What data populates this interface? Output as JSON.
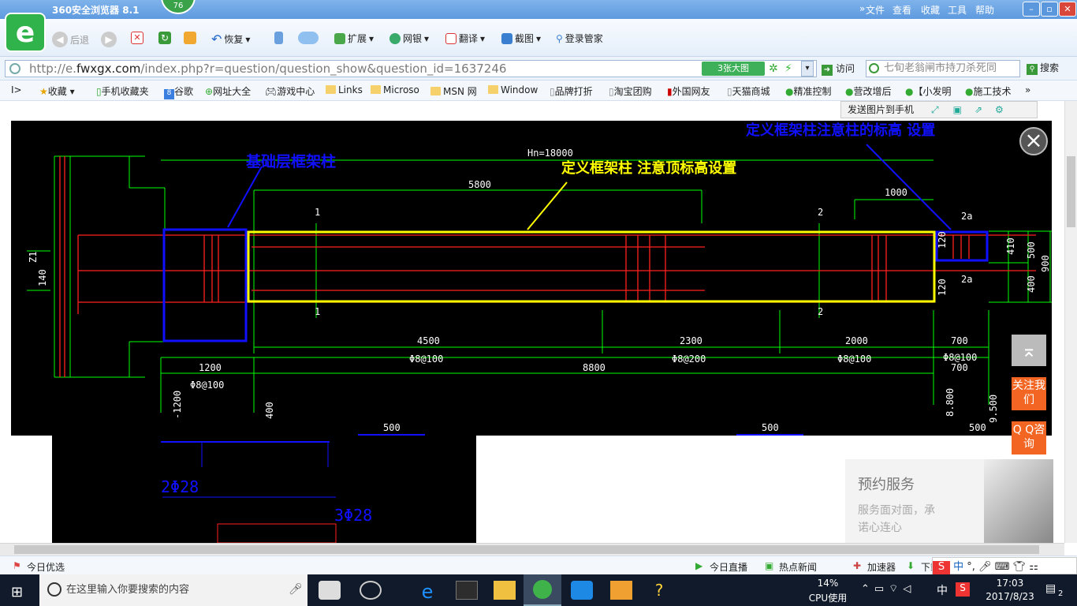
{
  "browser": {
    "title": "360安全浏览器 8.1",
    "badge": "76",
    "logo": "e",
    "menu": [
      "文件",
      "查看",
      "收藏",
      "工具",
      "帮助"
    ],
    "toolbar": {
      "back": "后退",
      "restore": "恢复",
      "extend": "扩展",
      "bank": "网银",
      "translate": "翻译",
      "screenshot": "截图",
      "login": "登录管家"
    },
    "address": {
      "prefix": "http://e.",
      "host": "fwxgx.com",
      "path": "/index.php?r=question/question_show&question_id=1637246"
    },
    "big_image": "3张大图",
    "visit": "访问",
    "search_placeholder": "七旬老翁闸市持刀杀死同",
    "search_button": "搜索",
    "favorites": [
      "收藏",
      "手机收藏夹",
      "谷歌",
      "网址大全",
      "游戏中心",
      "Links",
      "Microso",
      "MSN 网",
      "Window",
      "品牌打折",
      "淘宝团购",
      "外国网友",
      "天猫商城",
      "精准控制",
      "营改增后",
      "【小发明",
      "施工技术"
    ]
  },
  "viewer": {
    "send_to_phone": "发送图片到手机",
    "close": "×"
  },
  "drawing": {
    "ann_foundation": "基础层框架柱",
    "ann_frame": "定义框架柱 注意顶标高设置",
    "ann_column": "定义框架柱注意柱的标高 设置",
    "hn": "Hn=18000",
    "dim_5800": "5800",
    "dim_1000": "1000",
    "dim_4500": "4500",
    "dim_2300": "2300",
    "dim_2000": "2000",
    "dim_700a": "700",
    "dim_1200": "1200",
    "dim_8800": "8800",
    "dim_700b": "700",
    "st_100a": "Φ8@100",
    "st_100b": "Φ8@100",
    "st_200": "Φ8@200",
    "st_100c": "Φ8@100",
    "st_100d": "Φ8@100",
    "dim_m1200": "-1200",
    "dim_400": "400",
    "dim_8800v": "8.800",
    "dim_9500": "9.500",
    "dim_410": "410",
    "dim_500": "500",
    "dim_900": "900",
    "dim_400v": "400",
    "dim_120a": "120",
    "dim_120b": "120",
    "lbl_21": "Z1",
    "lbl_140": "140",
    "mark_1a": "1",
    "mark_1b": "1",
    "mark_2a": "2",
    "mark_2b": "2",
    "mark_2c": "2a",
    "mark_2d": "2a",
    "below_500a": "500",
    "below_500b": "500",
    "below_500c": "500",
    "rebar_a": "2Φ28",
    "rebar_b": "3Φ28"
  },
  "page": {
    "reserve_title": "预约服务",
    "reserve_text1": "服务面对面，承",
    "reserve_text2": "诺心连心",
    "follow": "关注我们",
    "qq": "Q Q咨询"
  },
  "status": {
    "left": "今日优选",
    "live": "今日直播",
    "news": "热点新闻",
    "speed": "加速器",
    "download": "下载"
  },
  "taskbar": {
    "search": "在这里输入你要搜索的内容",
    "cpu_pct": "14%",
    "cpu_label": "CPU使用",
    "ime": "中",
    "time": "17:03",
    "date": "2017/8/23",
    "notif": "2"
  },
  "colors": {
    "green": "#00ff00",
    "red": "#ff2020",
    "yellow": "#ffff00",
    "blue": "#1010ff",
    "white": "#ffffff"
  }
}
